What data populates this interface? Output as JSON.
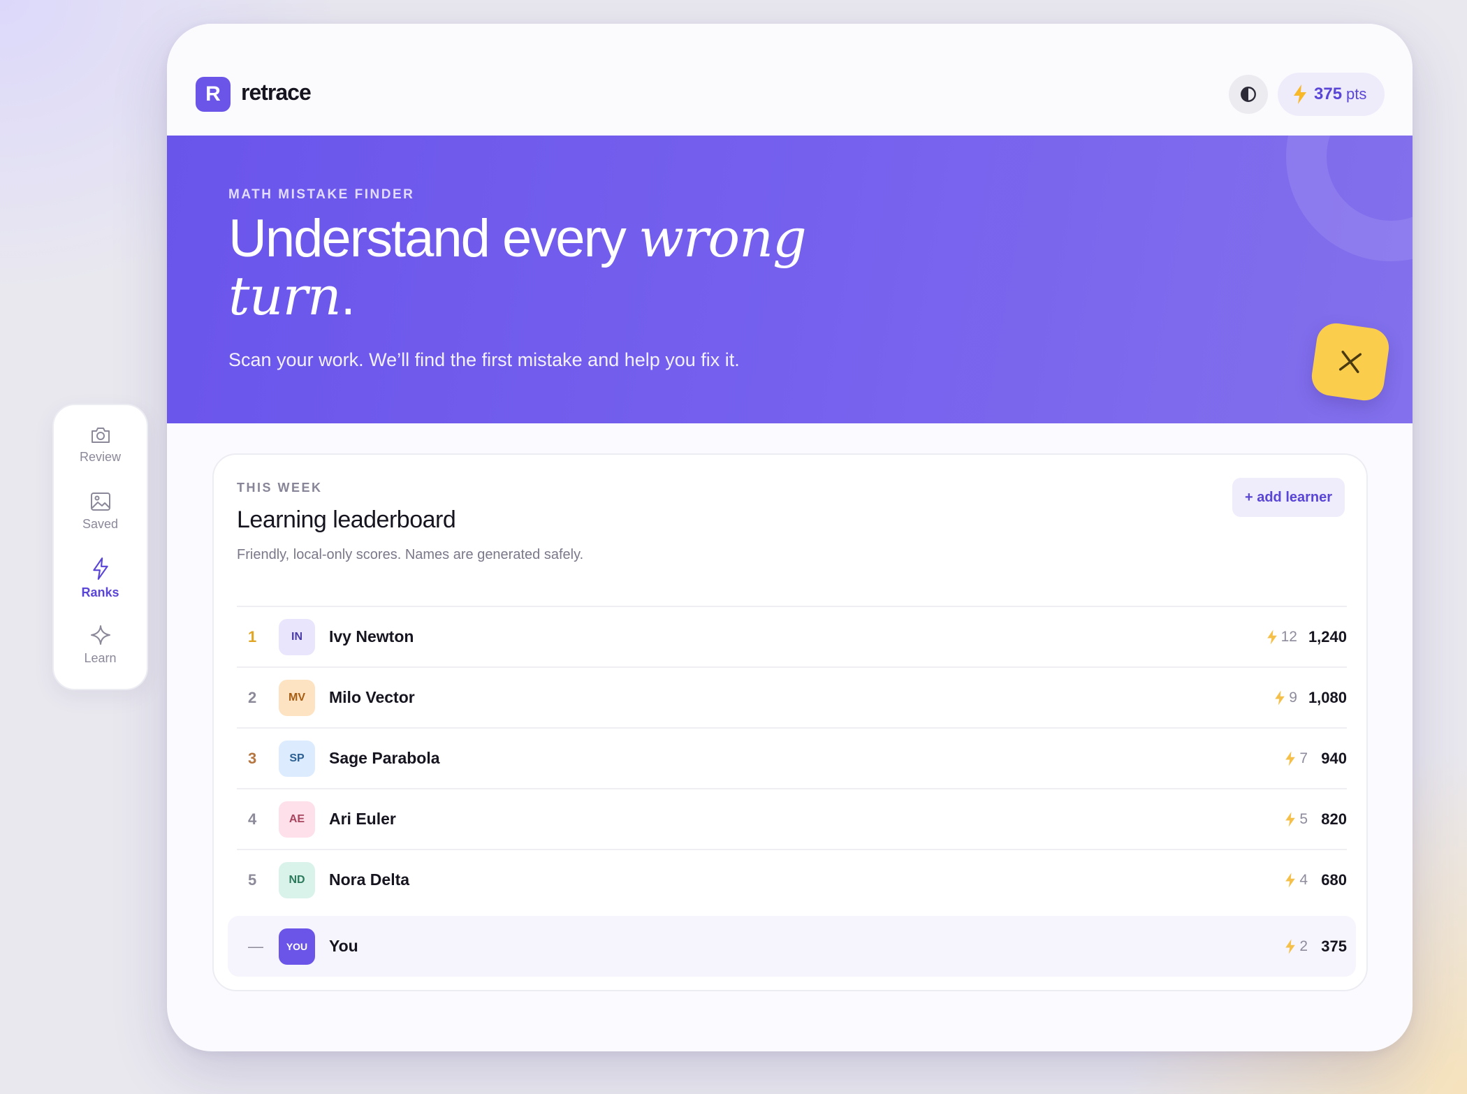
{
  "app": {
    "logo_letter": "R",
    "name": "retrace"
  },
  "header": {
    "points_value": "375",
    "points_unit": "pts",
    "theme_icon": "contrast-icon",
    "points_icon": "bolt-icon"
  },
  "hero": {
    "eyebrow": "MATH MISTAKE FINDER",
    "title_plain": "Understand every ",
    "title_italic": "wrong turn",
    "title_end": ".",
    "subtitle": "Scan your work. We’ll find the first mistake and help you fix it.",
    "fab_icon": "close-icon"
  },
  "leaderboard": {
    "eyebrow": "THIS WEEK",
    "title": "Learning leaderboard",
    "subtitle": "Friendly, local-only scores. Names are generated safely.",
    "add_button": "+ add learner",
    "rows": [
      {
        "rank": "1",
        "initials": "IN",
        "name": "Ivy Newton",
        "streak": "12",
        "score": "1,240"
      },
      {
        "rank": "2",
        "initials": "MV",
        "name": "Milo Vector",
        "streak": "9",
        "score": "1,080"
      },
      {
        "rank": "3",
        "initials": "SP",
        "name": "Sage Parabola",
        "streak": "7",
        "score": "940"
      },
      {
        "rank": "4",
        "initials": "AE",
        "name": "Ari Euler",
        "streak": "5",
        "score": "820"
      },
      {
        "rank": "5",
        "initials": "ND",
        "name": "Nora Delta",
        "streak": "4",
        "score": "680"
      }
    ],
    "you": {
      "rank": "—",
      "initials": "YOU",
      "name": "You",
      "streak": "2",
      "score": "375"
    }
  },
  "nav": {
    "items": [
      {
        "label": "Review",
        "icon": "camera-icon",
        "active": false
      },
      {
        "label": "Saved",
        "icon": "image-icon",
        "active": false
      },
      {
        "label": "Ranks",
        "icon": "bolt-icon",
        "active": true
      },
      {
        "label": "Learn",
        "icon": "sparkle-icon",
        "active": false
      }
    ]
  },
  "colors": {
    "accent": "#6a55e8",
    "gold": "#fbcd4c"
  }
}
